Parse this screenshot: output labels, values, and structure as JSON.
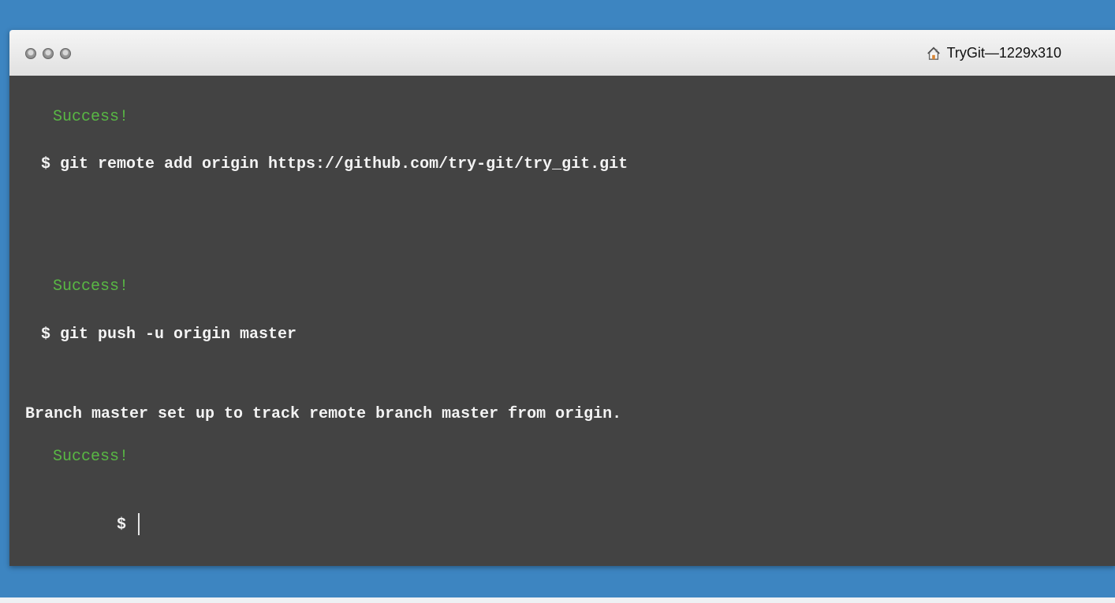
{
  "window": {
    "title": "TryGit—1229x310",
    "title_icon": "home-icon"
  },
  "terminal": {
    "lines": [
      {
        "type": "success",
        "text": "Success!"
      },
      {
        "type": "command",
        "text": "$ git remote add origin https://github.com/try-git/try_git.git"
      },
      {
        "type": "success",
        "text": "Success!"
      },
      {
        "type": "command",
        "text": "$ git push -u origin master"
      },
      {
        "type": "output",
        "text": "Branch master set up to track remote branch master from origin."
      },
      {
        "type": "success",
        "text": "Success!"
      },
      {
        "type": "prompt",
        "text": "$"
      }
    ]
  },
  "colors": {
    "desktop": "#3d85c1",
    "terminal_background": "#434343",
    "success_text": "#59b844",
    "terminal_text": "#f3f3f3"
  }
}
